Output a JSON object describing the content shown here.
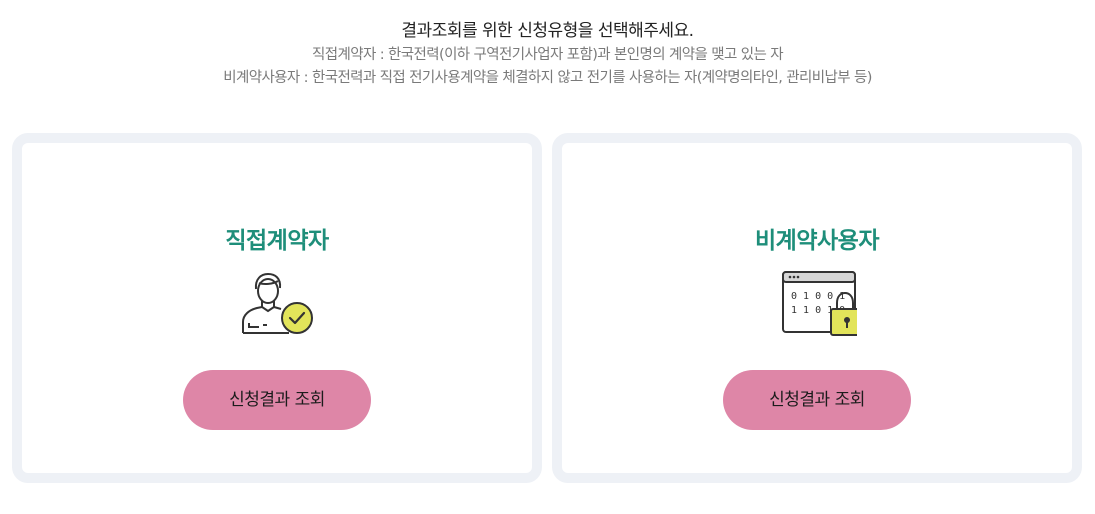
{
  "intro": {
    "title": "결과조회를 위한 신청유형을 선택해주세요.",
    "line1": "직접계약자 : 한국전력(이하 구역전기사업자 포함)과 본인명의 계약을 맺고 있는 자",
    "line2": "비계약사용자 : 한국전력과 직접 전기사용계약을 체결하지 않고 전기를 사용하는 자(계약명의타인, 관리비납부 등)"
  },
  "cards": [
    {
      "title": "직접계약자",
      "icon": "person-check-icon",
      "button_label": "신청결과 조회"
    },
    {
      "title": "비계약사용자",
      "icon": "locked-data-window-icon",
      "button_label": "신청결과 조회",
      "icon_binary_lines": [
        "0 1 0 0 1",
        "1 1 0 1 0"
      ]
    }
  ],
  "colors": {
    "accent_green": "#1e8e7a",
    "button_pink": "#de86a7",
    "card_border": "#eef1f6",
    "icon_yellow": "#e2e45a",
    "icon_stroke": "#333333"
  }
}
